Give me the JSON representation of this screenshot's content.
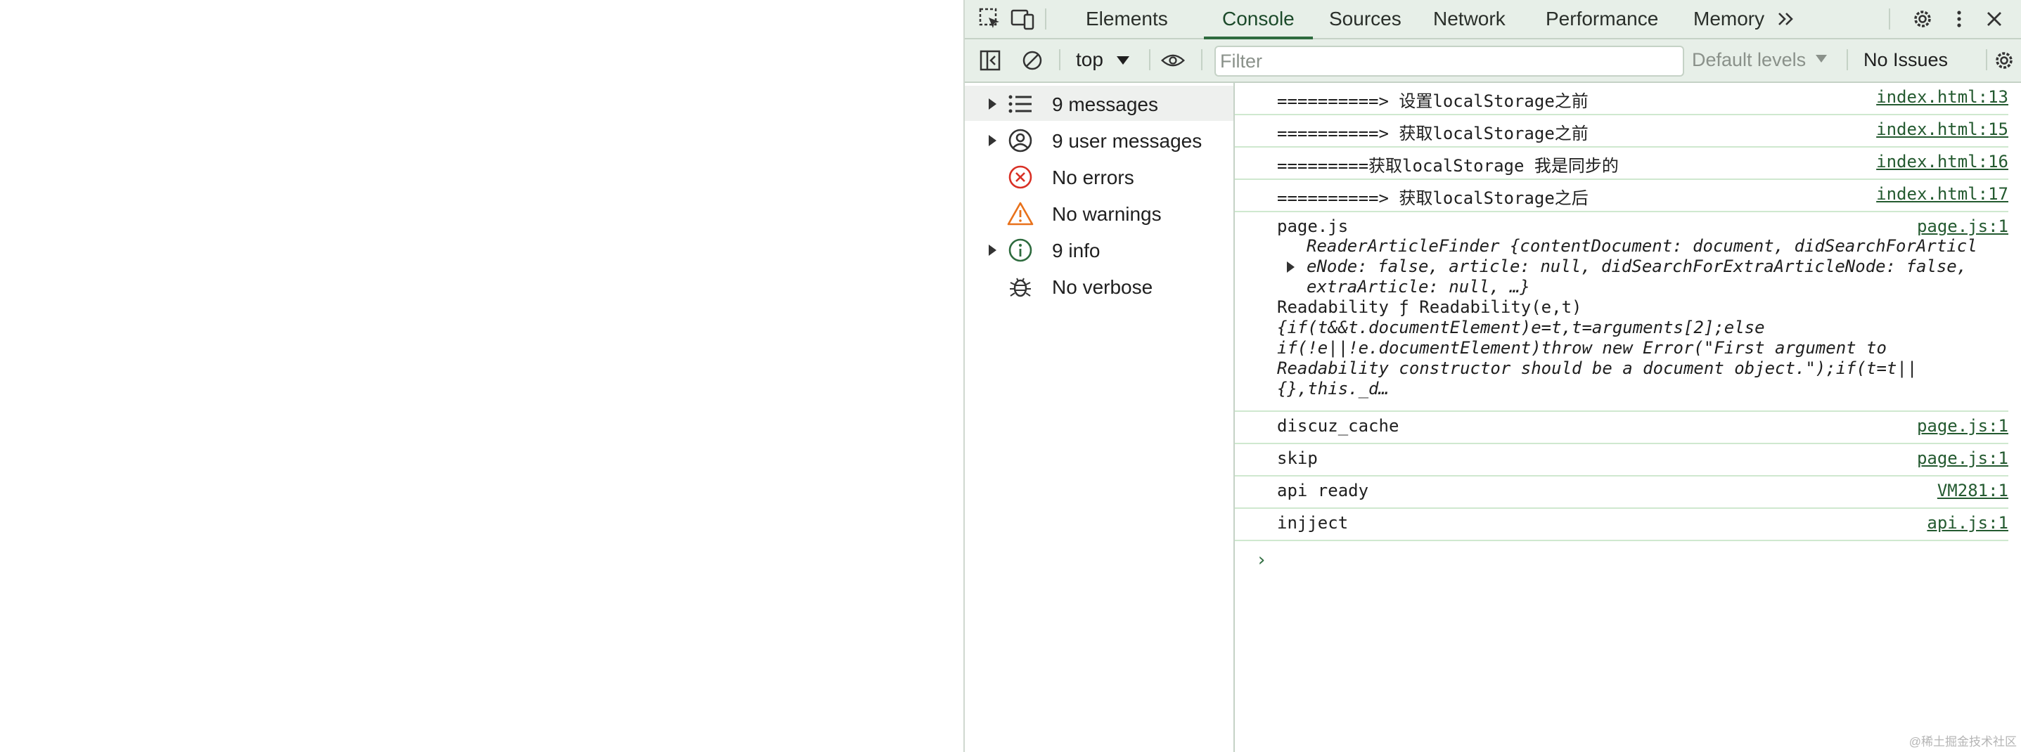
{
  "devtools": {
    "tabs": [
      "Elements",
      "Console",
      "Sources",
      "Network",
      "Performance",
      "Memory"
    ],
    "active_tab": "Console",
    "overflow_icon": "double-chevron-right-icon"
  },
  "toolbar": {
    "context": "top",
    "filter_placeholder": "Filter",
    "filter_value": "",
    "levels": "Default levels",
    "issues": "No Issues"
  },
  "sidebar": {
    "items": [
      {
        "label": "9 messages",
        "icon": "list-icon",
        "expandable": true,
        "selected": true
      },
      {
        "label": "9 user messages",
        "icon": "user-icon",
        "expandable": true
      },
      {
        "label": "No errors",
        "icon": "error-icon",
        "expandable": false
      },
      {
        "label": "No warnings",
        "icon": "warning-icon",
        "expandable": false
      },
      {
        "label": "9 info",
        "icon": "info-icon",
        "expandable": true
      },
      {
        "label": "No verbose",
        "icon": "bug-icon",
        "expandable": false
      }
    ]
  },
  "console": {
    "messages": [
      {
        "text": "==========> 设置localStorage之前",
        "source": "index.html:13"
      },
      {
        "text": "==========> 获取localStorage之前",
        "source": "index.html:15"
      },
      {
        "text": "=========获取localStorage 我是同步的",
        "source": "index.html:16"
      },
      {
        "text": "==========> 获取localStorage之后",
        "source": "index.html:17"
      },
      {
        "text": "page.js",
        "source": "page.js:1",
        "object_lines": [
          "ReaderArticleFinder {contentDocument: document, didSearchForArticl",
          "eNode: false, article: null, didSearchForExtraArticleNode: false,",
          "extraArticle: null, …}"
        ],
        "readability_lines": [
          "Readability ƒ Readability(e,t)",
          "{if(t&&t.documentElement)e=t,t=arguments[2];else",
          "if(!e||!e.documentElement)throw new Error(\"First argument to",
          "Readability constructor should be a document object.\");if(t=t||",
          "{},this._d…"
        ]
      },
      {
        "text": "discuz_cache",
        "source": "page.js:1"
      },
      {
        "text": "skip",
        "source": "page.js:1"
      },
      {
        "text": "api ready",
        "source": "VM281:1"
      },
      {
        "text": "injject",
        "source": "api.js:1"
      }
    ],
    "prompt": "›"
  },
  "watermark": "@稀土掘金技术社区",
  "colors": {
    "toolbar_bg": "#e7efe8",
    "accent": "#2e6b3e",
    "row_border": "#cfe8cf"
  }
}
